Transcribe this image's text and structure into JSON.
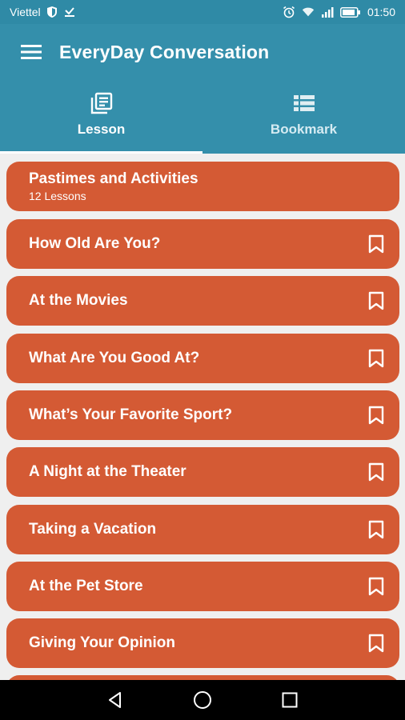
{
  "status": {
    "carrier": "Viettel",
    "time": "01:50",
    "icons": [
      "shield-icon",
      "download-check-icon",
      "alarm-icon",
      "wifi-icon",
      "signal-icon",
      "battery-icon"
    ]
  },
  "appbar": {
    "title": "EveryDay Conversation",
    "menu_icon": "hamburger-menu-icon"
  },
  "tabs": [
    {
      "label": "Lesson",
      "icon": "lesson-list-icon",
      "active": true
    },
    {
      "label": "Bookmark",
      "icon": "bookmark-list-icon",
      "active": false
    }
  ],
  "category": {
    "title": "Pastimes and Activities",
    "subtitle": "12 Lessons"
  },
  "lessons": [
    {
      "title": "How Old Are You?"
    },
    {
      "title": "At the Movies"
    },
    {
      "title": "What Are You Good At?"
    },
    {
      "title": "What’s Your Favorite Sport?"
    },
    {
      "title": "A Night at the Theater"
    },
    {
      "title": "Taking a Vacation"
    },
    {
      "title": "At the Pet Store"
    },
    {
      "title": "Giving Your Opinion"
    },
    {
      "title": ""
    }
  ],
  "colors": {
    "appbar": "#348fab",
    "card": "#d45a34",
    "background": "#efefef"
  },
  "navbar": {
    "buttons": [
      "back-icon",
      "home-icon",
      "recents-icon"
    ]
  }
}
